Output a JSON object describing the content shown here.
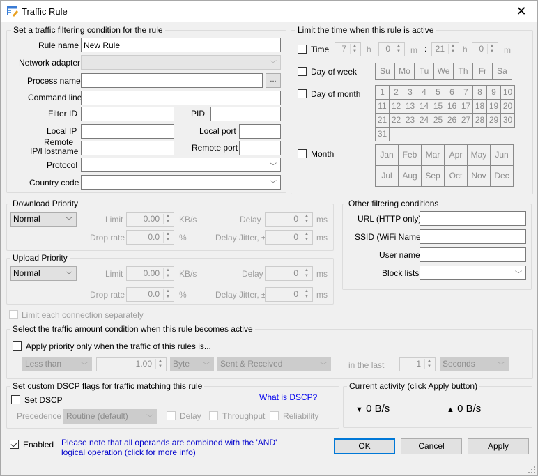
{
  "window": {
    "title": "Traffic Rule",
    "close_label": "✕"
  },
  "filter": {
    "title": "Set a traffic filtering condition for the rule",
    "rule_name_label": "Rule name",
    "rule_name_value": "New Rule",
    "network_adapter_label": "Network adapter",
    "network_adapter_value": "",
    "process_name_label": "Process name",
    "process_name_value": "",
    "browse_label": "...",
    "command_line_label": "Command line",
    "filter_id_label": "Filter ID",
    "pid_label": "PID",
    "local_ip_label": "Local IP",
    "local_port_label": "Local port",
    "remote_ip_label_1": "Remote",
    "remote_ip_label_2": "IP/Hostname",
    "remote_port_label": "Remote port",
    "protocol_label": "Protocol",
    "country_code_label": "Country code"
  },
  "time": {
    "title": "Limit the time when this rule is active",
    "time_label": "Time",
    "start_hour": "7",
    "start_min": "0",
    "end_hour": "21",
    "end_min": "0",
    "h": "h",
    "m": "m",
    "colon": ":",
    "day_of_week_label": "Day of week",
    "weekdays": [
      "Su",
      "Mo",
      "Tu",
      "We",
      "Th",
      "Fr",
      "Sa"
    ],
    "day_of_month_label": "Day of month",
    "days": [
      "1",
      "2",
      "3",
      "4",
      "5",
      "6",
      "7",
      "8",
      "9",
      "10",
      "11",
      "12",
      "13",
      "14",
      "15",
      "16",
      "17",
      "18",
      "19",
      "20",
      "21",
      "22",
      "23",
      "24",
      "25",
      "26",
      "27",
      "28",
      "29",
      "30",
      "31"
    ],
    "month_label": "Month",
    "months": [
      "Jan",
      "Feb",
      "Mar",
      "Apr",
      "May",
      "Jun",
      "Jul",
      "Aug",
      "Sep",
      "Oct",
      "Nov",
      "Dec"
    ]
  },
  "download": {
    "title": "Download Priority",
    "priority": "Normal",
    "limit_label": "Limit",
    "limit_value": "0.00",
    "limit_unit": "KB/s",
    "delay_label": "Delay",
    "delay_value": "0",
    "delay_unit": "ms",
    "drop_label": "Drop rate",
    "drop_value": "0.0",
    "drop_unit": "%",
    "jitter_label": "Delay Jitter, ±",
    "jitter_value": "0",
    "jitter_unit": "ms"
  },
  "upload": {
    "title": "Upload Priority",
    "priority": "Normal",
    "limit_label": "Limit",
    "limit_value": "0.00",
    "limit_unit": "KB/s",
    "delay_label": "Delay",
    "delay_value": "0",
    "delay_unit": "ms",
    "drop_label": "Drop rate",
    "drop_value": "0.0",
    "drop_unit": "%",
    "jitter_label": "Delay Jitter, ±",
    "jitter_value": "0",
    "jitter_unit": "ms"
  },
  "limit_each_label": "Limit each connection separately",
  "other": {
    "title": "Other filtering conditions",
    "url_label": "URL (HTTP only)",
    "ssid_label": "SSID (WiFi Name)",
    "user_label": "User name",
    "block_label": "Block lists"
  },
  "amount": {
    "title": "Select the traffic amount condition when this rule becomes active",
    "apply_label": "Apply priority only when the traffic of this rules is...",
    "comparison": "Less than",
    "amount_value": "1.00",
    "unit": "Byte",
    "direction": "Sent & Received",
    "in_last_label": "in the last",
    "period_value": "1",
    "period_unit": "Seconds"
  },
  "dscp": {
    "title": "Set custom DSCP flags for traffic matching this rule",
    "set_label": "Set DSCP",
    "what_link": "What is DSCP?",
    "precedence_label": "Precedence",
    "precedence_value": "Routine (default)",
    "delay_label": "Delay",
    "throughput_label": "Throughput",
    "reliability_label": "Reliability"
  },
  "activity": {
    "title": "Current activity (click Apply button)",
    "down_icon": "▼",
    "down_value": "0 B/s",
    "up_icon": "▲",
    "up_value": "0 B/s"
  },
  "footer": {
    "enabled_label": "Enabled",
    "note": "Please note that all operands are combined with the 'AND' logical operation (click for more info)",
    "ok": "OK",
    "cancel": "Cancel",
    "apply": "Apply"
  },
  "colors": {
    "accent": "#0078d7",
    "link": "#0000ee",
    "note": "#0000cc"
  }
}
